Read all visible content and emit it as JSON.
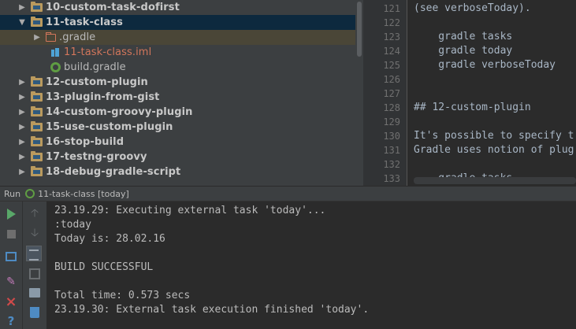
{
  "tree": {
    "items": [
      {
        "label": "10-custom-task-dofirst",
        "expanded": false
      },
      {
        "label": "11-task-class",
        "expanded": true
      },
      {
        "label": ".gradle",
        "expanded": false
      },
      {
        "label": "11-task-class.iml"
      },
      {
        "label": "build.gradle"
      },
      {
        "label": "12-custom-plugin",
        "expanded": false
      },
      {
        "label": "13-plugin-from-gist",
        "expanded": false
      },
      {
        "label": "14-custom-groovy-plugin",
        "expanded": false
      },
      {
        "label": "15-use-custom-plugin",
        "expanded": false
      },
      {
        "label": "16-stop-build",
        "expanded": false
      },
      {
        "label": "17-testng-groovy",
        "expanded": false
      },
      {
        "label": "18-debug-gradle-script",
        "expanded": false
      }
    ]
  },
  "editor": {
    "lines": [
      {
        "number": "121",
        "text": "(see verboseToday)."
      },
      {
        "number": "122",
        "text": ""
      },
      {
        "number": "123",
        "text": "    gradle tasks"
      },
      {
        "number": "124",
        "text": "    gradle today"
      },
      {
        "number": "125",
        "text": "    gradle verboseToday"
      },
      {
        "number": "126",
        "text": ""
      },
      {
        "number": "127",
        "text": ""
      },
      {
        "number": "128",
        "text": "## 12-custom-plugin"
      },
      {
        "number": "129",
        "text": ""
      },
      {
        "number": "130",
        "text": "It's possible to specify t"
      },
      {
        "number": "131",
        "text": "Gradle uses notion of plug"
      },
      {
        "number": "132",
        "text": ""
      },
      {
        "number": "133",
        "text": "    gradle tasks"
      }
    ]
  },
  "run": {
    "title": "Run",
    "config_name": "11-task-class [today]"
  },
  "console": {
    "lines": [
      "23.19.29: Executing external task 'today'...",
      ":today",
      "Today is: 28.02.16",
      "",
      "BUILD SUCCESSFUL",
      "",
      "Total time: 0.573 secs",
      "23.19.30: External task execution finished 'today'."
    ]
  },
  "colors": {
    "tree_bg": "#3c3f41",
    "selected_row": "#0d293e",
    "highlight_row": "#4a4637",
    "folder": "#ba9a5e",
    "excluded_folder": "#d2765b",
    "editor_bg": "#2b2b2b",
    "gutter_bg": "#313335",
    "run_green": "#59a869"
  }
}
